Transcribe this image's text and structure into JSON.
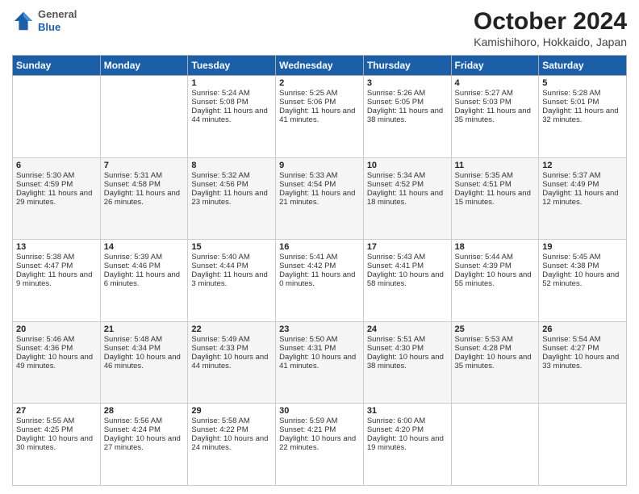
{
  "header": {
    "logo_general": "General",
    "logo_blue": "Blue",
    "title": "October 2024",
    "subtitle": "Kamishihoro, Hokkaido, Japan"
  },
  "days_of_week": [
    "Sunday",
    "Monday",
    "Tuesday",
    "Wednesday",
    "Thursday",
    "Friday",
    "Saturday"
  ],
  "weeks": [
    [
      {
        "day": "",
        "sunrise": "",
        "sunset": "",
        "daylight": ""
      },
      {
        "day": "",
        "sunrise": "",
        "sunset": "",
        "daylight": ""
      },
      {
        "day": "1",
        "sunrise": "Sunrise: 5:24 AM",
        "sunset": "Sunset: 5:08 PM",
        "daylight": "Daylight: 11 hours and 44 minutes."
      },
      {
        "day": "2",
        "sunrise": "Sunrise: 5:25 AM",
        "sunset": "Sunset: 5:06 PM",
        "daylight": "Daylight: 11 hours and 41 minutes."
      },
      {
        "day": "3",
        "sunrise": "Sunrise: 5:26 AM",
        "sunset": "Sunset: 5:05 PM",
        "daylight": "Daylight: 11 hours and 38 minutes."
      },
      {
        "day": "4",
        "sunrise": "Sunrise: 5:27 AM",
        "sunset": "Sunset: 5:03 PM",
        "daylight": "Daylight: 11 hours and 35 minutes."
      },
      {
        "day": "5",
        "sunrise": "Sunrise: 5:28 AM",
        "sunset": "Sunset: 5:01 PM",
        "daylight": "Daylight: 11 hours and 32 minutes."
      }
    ],
    [
      {
        "day": "6",
        "sunrise": "Sunrise: 5:30 AM",
        "sunset": "Sunset: 4:59 PM",
        "daylight": "Daylight: 11 hours and 29 minutes."
      },
      {
        "day": "7",
        "sunrise": "Sunrise: 5:31 AM",
        "sunset": "Sunset: 4:58 PM",
        "daylight": "Daylight: 11 hours and 26 minutes."
      },
      {
        "day": "8",
        "sunrise": "Sunrise: 5:32 AM",
        "sunset": "Sunset: 4:56 PM",
        "daylight": "Daylight: 11 hours and 23 minutes."
      },
      {
        "day": "9",
        "sunrise": "Sunrise: 5:33 AM",
        "sunset": "Sunset: 4:54 PM",
        "daylight": "Daylight: 11 hours and 21 minutes."
      },
      {
        "day": "10",
        "sunrise": "Sunrise: 5:34 AM",
        "sunset": "Sunset: 4:52 PM",
        "daylight": "Daylight: 11 hours and 18 minutes."
      },
      {
        "day": "11",
        "sunrise": "Sunrise: 5:35 AM",
        "sunset": "Sunset: 4:51 PM",
        "daylight": "Daylight: 11 hours and 15 minutes."
      },
      {
        "day": "12",
        "sunrise": "Sunrise: 5:37 AM",
        "sunset": "Sunset: 4:49 PM",
        "daylight": "Daylight: 11 hours and 12 minutes."
      }
    ],
    [
      {
        "day": "13",
        "sunrise": "Sunrise: 5:38 AM",
        "sunset": "Sunset: 4:47 PM",
        "daylight": "Daylight: 11 hours and 9 minutes."
      },
      {
        "day": "14",
        "sunrise": "Sunrise: 5:39 AM",
        "sunset": "Sunset: 4:46 PM",
        "daylight": "Daylight: 11 hours and 6 minutes."
      },
      {
        "day": "15",
        "sunrise": "Sunrise: 5:40 AM",
        "sunset": "Sunset: 4:44 PM",
        "daylight": "Daylight: 11 hours and 3 minutes."
      },
      {
        "day": "16",
        "sunrise": "Sunrise: 5:41 AM",
        "sunset": "Sunset: 4:42 PM",
        "daylight": "Daylight: 11 hours and 0 minutes."
      },
      {
        "day": "17",
        "sunrise": "Sunrise: 5:43 AM",
        "sunset": "Sunset: 4:41 PM",
        "daylight": "Daylight: 10 hours and 58 minutes."
      },
      {
        "day": "18",
        "sunrise": "Sunrise: 5:44 AM",
        "sunset": "Sunset: 4:39 PM",
        "daylight": "Daylight: 10 hours and 55 minutes."
      },
      {
        "day": "19",
        "sunrise": "Sunrise: 5:45 AM",
        "sunset": "Sunset: 4:38 PM",
        "daylight": "Daylight: 10 hours and 52 minutes."
      }
    ],
    [
      {
        "day": "20",
        "sunrise": "Sunrise: 5:46 AM",
        "sunset": "Sunset: 4:36 PM",
        "daylight": "Daylight: 10 hours and 49 minutes."
      },
      {
        "day": "21",
        "sunrise": "Sunrise: 5:48 AM",
        "sunset": "Sunset: 4:34 PM",
        "daylight": "Daylight: 10 hours and 46 minutes."
      },
      {
        "day": "22",
        "sunrise": "Sunrise: 5:49 AM",
        "sunset": "Sunset: 4:33 PM",
        "daylight": "Daylight: 10 hours and 44 minutes."
      },
      {
        "day": "23",
        "sunrise": "Sunrise: 5:50 AM",
        "sunset": "Sunset: 4:31 PM",
        "daylight": "Daylight: 10 hours and 41 minutes."
      },
      {
        "day": "24",
        "sunrise": "Sunrise: 5:51 AM",
        "sunset": "Sunset: 4:30 PM",
        "daylight": "Daylight: 10 hours and 38 minutes."
      },
      {
        "day": "25",
        "sunrise": "Sunrise: 5:53 AM",
        "sunset": "Sunset: 4:28 PM",
        "daylight": "Daylight: 10 hours and 35 minutes."
      },
      {
        "day": "26",
        "sunrise": "Sunrise: 5:54 AM",
        "sunset": "Sunset: 4:27 PM",
        "daylight": "Daylight: 10 hours and 33 minutes."
      }
    ],
    [
      {
        "day": "27",
        "sunrise": "Sunrise: 5:55 AM",
        "sunset": "Sunset: 4:25 PM",
        "daylight": "Daylight: 10 hours and 30 minutes."
      },
      {
        "day": "28",
        "sunrise": "Sunrise: 5:56 AM",
        "sunset": "Sunset: 4:24 PM",
        "daylight": "Daylight: 10 hours and 27 minutes."
      },
      {
        "day": "29",
        "sunrise": "Sunrise: 5:58 AM",
        "sunset": "Sunset: 4:22 PM",
        "daylight": "Daylight: 10 hours and 24 minutes."
      },
      {
        "day": "30",
        "sunrise": "Sunrise: 5:59 AM",
        "sunset": "Sunset: 4:21 PM",
        "daylight": "Daylight: 10 hours and 22 minutes."
      },
      {
        "day": "31",
        "sunrise": "Sunrise: 6:00 AM",
        "sunset": "Sunset: 4:20 PM",
        "daylight": "Daylight: 10 hours and 19 minutes."
      },
      {
        "day": "",
        "sunrise": "",
        "sunset": "",
        "daylight": ""
      },
      {
        "day": "",
        "sunrise": "",
        "sunset": "",
        "daylight": ""
      }
    ]
  ]
}
